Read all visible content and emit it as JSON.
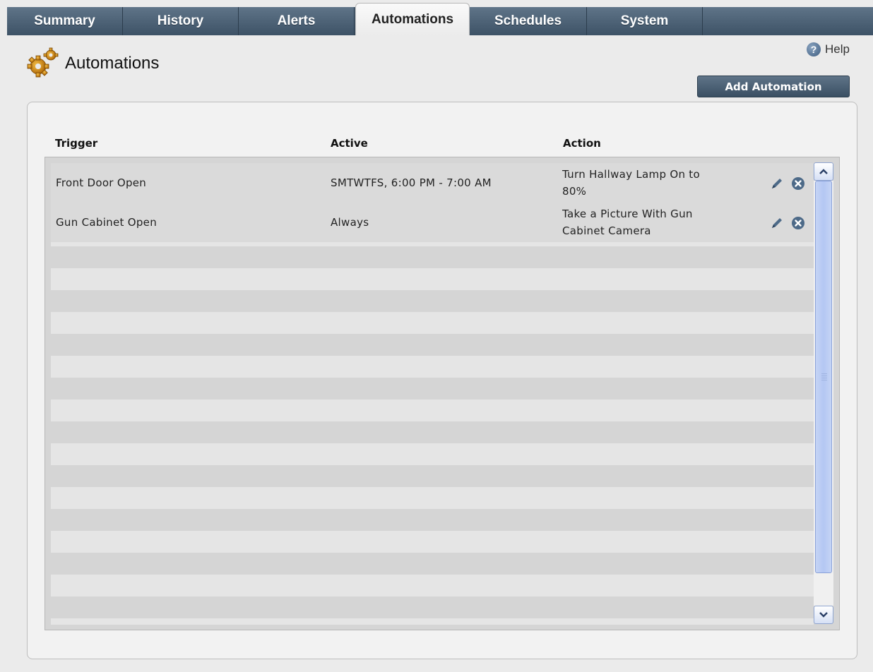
{
  "tabs": [
    {
      "label": "Summary",
      "active": false
    },
    {
      "label": "History",
      "active": false
    },
    {
      "label": "Alerts",
      "active": false
    },
    {
      "label": "Automations",
      "active": true
    },
    {
      "label": "Schedules",
      "active": false
    },
    {
      "label": "System",
      "active": false
    }
  ],
  "header": {
    "title": "Automations",
    "icon": "gears-icon",
    "help_label": "Help",
    "help_icon": "question-icon",
    "add_button": "Add Automation"
  },
  "table": {
    "columns": {
      "trigger": "Trigger",
      "active": "Active",
      "action": "Action"
    },
    "rows": [
      {
        "trigger": "Front Door Open",
        "active": "SMTWTFS, 6:00 PM - 7:00 AM",
        "action_line1": "Turn Hallway Lamp On to",
        "action_line2": "80%"
      },
      {
        "trigger": "Gun Cabinet Open",
        "active": "Always",
        "action_line1": "Take a Picture With Gun",
        "action_line2": "Cabinet Camera"
      }
    ],
    "row_icons": [
      "pencil-icon",
      "delete-circle-x-icon"
    ]
  },
  "colors": {
    "tab_bg": "#4e6377",
    "button_bg": "#4a5f73",
    "page_bg": "#ebebeb",
    "scroll_thumb": "#b4c7f3"
  }
}
